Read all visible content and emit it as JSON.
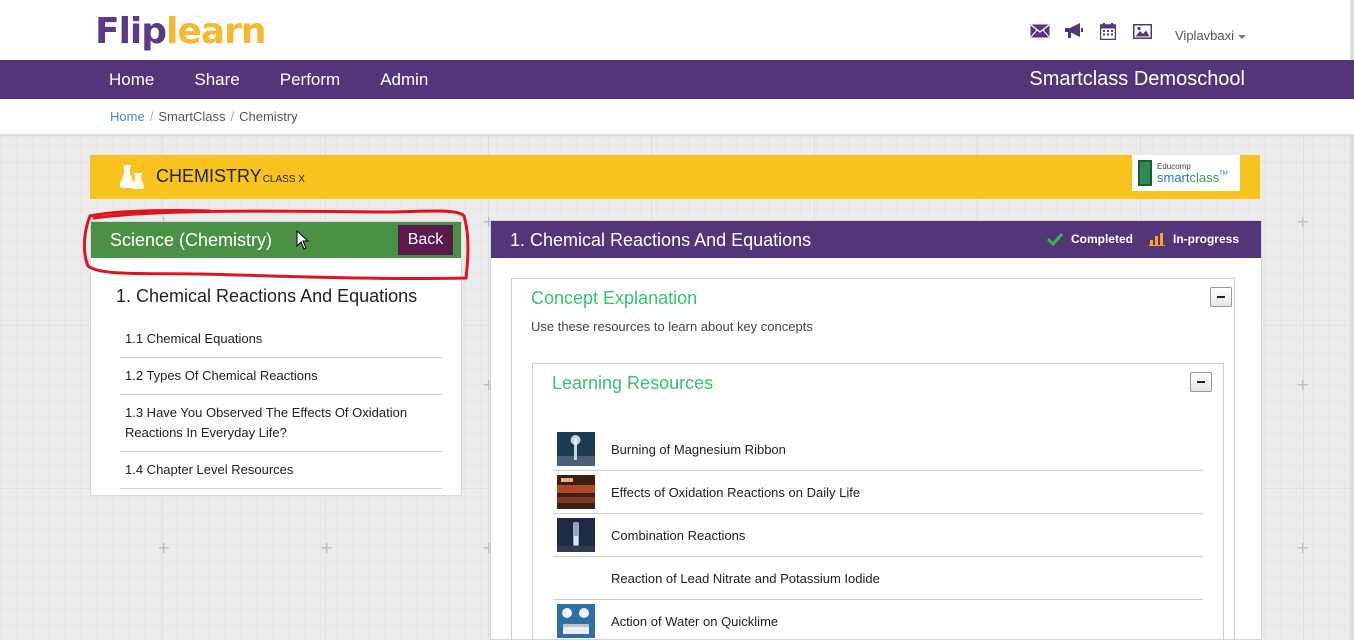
{
  "brand": {
    "logo_part1": "Flip",
    "logo_part2": "learn"
  },
  "header": {
    "icons": [
      "mail-icon",
      "megaphone-icon",
      "calendar-icon",
      "image-icon"
    ],
    "user_name": "Viplavbaxi"
  },
  "nav": {
    "items": [
      "Home",
      "Share",
      "Perform",
      "Admin"
    ],
    "school_name": "Smartclass Demoschool"
  },
  "breadcrumb": {
    "home": "Home",
    "level1": "SmartClass",
    "level2": "Chemistry"
  },
  "banner": {
    "subject": "CHEMISTRY",
    "class_label": "CLASS X",
    "partner_logo": {
      "line1": "Educomp",
      "line2a": "smart",
      "line2b": "class",
      "tm": "TM"
    }
  },
  "left_panel": {
    "title": "Science (Chemistry)",
    "back_label": "Back",
    "chapter": "1. Chemical Reactions And Equations",
    "topics": [
      "1.1 Chemical Equations",
      "1.2 Types Of Chemical Reactions",
      "1.3 Have You Observed The Effects Of Oxidation Reactions In Everyday Life?",
      "1.4 Chapter Level Resources"
    ]
  },
  "right_panel": {
    "title": "1. Chemical Reactions And Equations",
    "legend_completed": "Completed",
    "legend_inprogress": "In-progress",
    "concept": {
      "title": "Concept Explanation",
      "description": "Use these resources to learn about key concepts"
    },
    "resources": {
      "title": "Learning Resources",
      "items": [
        {
          "label": "Burning of Magnesium Ribbon",
          "has_thumb": true
        },
        {
          "label": "Effects of Oxidation Reactions on Daily Life",
          "has_thumb": true
        },
        {
          "label": "Combination Reactions",
          "has_thumb": true
        },
        {
          "label": "Reaction of Lead Nitrate and Potassium Iodide",
          "has_thumb": false
        },
        {
          "label": "Action of Water on Quicklime",
          "has_thumb": true
        }
      ]
    }
  },
  "colors": {
    "brand_purple": "#53357a",
    "brand_yellow": "#f9c31d",
    "header_green": "#4b9145",
    "accent_green": "#34c46f",
    "back_button": "#5a1a4e",
    "annotation_red": "#e0141e"
  }
}
